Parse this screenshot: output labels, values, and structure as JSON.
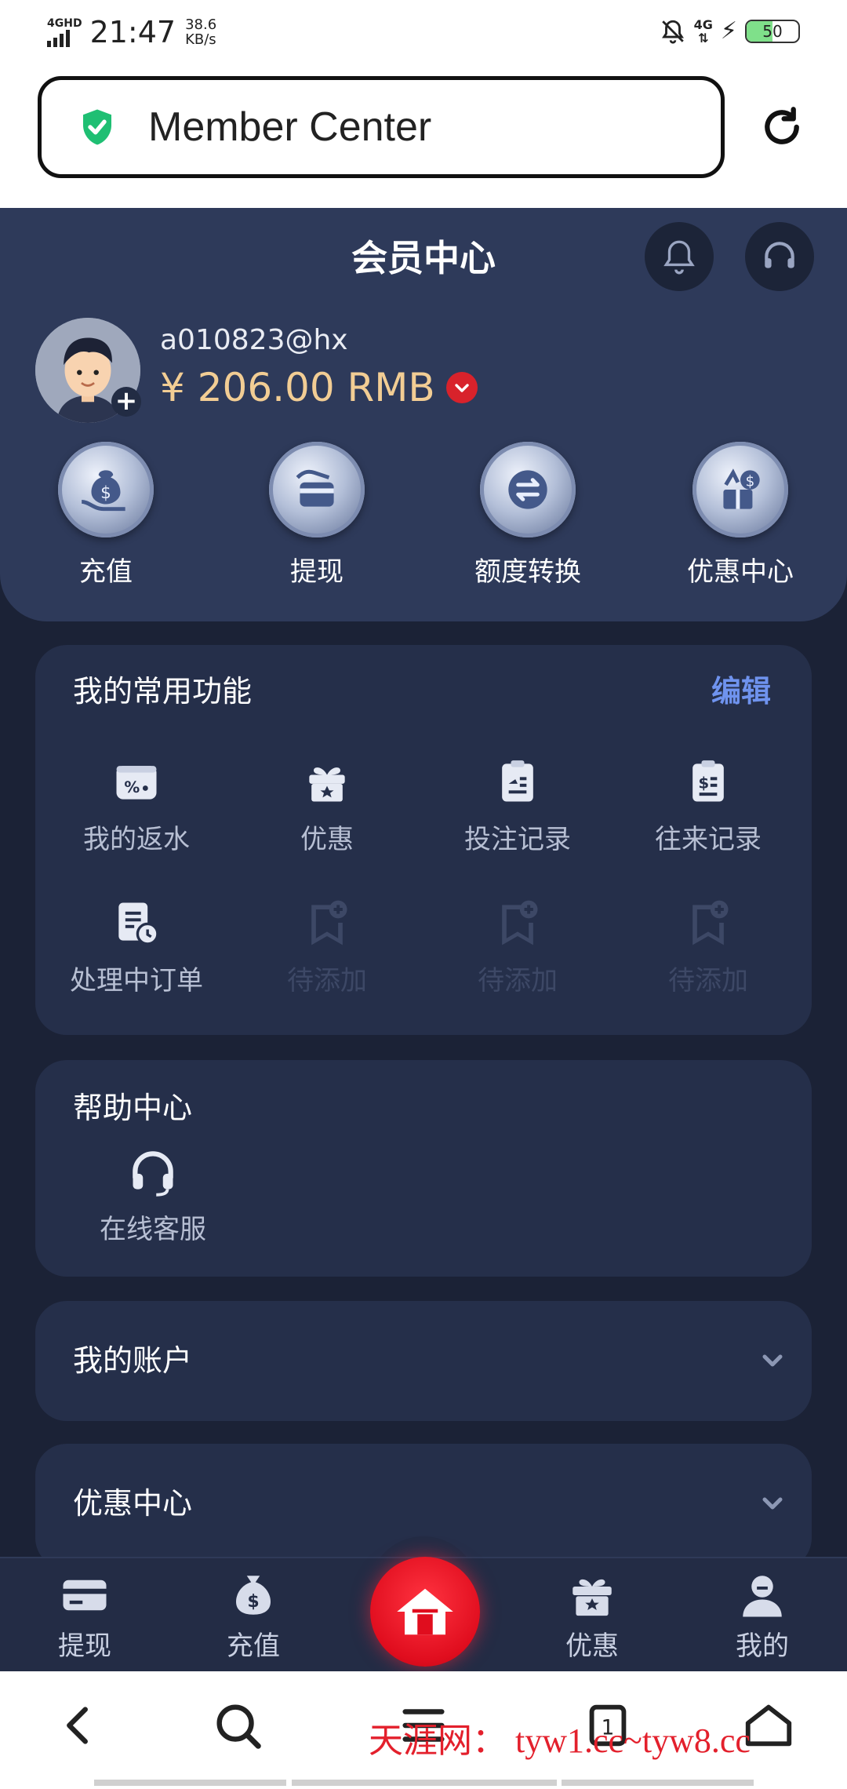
{
  "status_bar": {
    "network": "4GHD",
    "time": "21:47",
    "speed_value": "38.6",
    "speed_unit": "KB/s",
    "cell_label": "4G",
    "battery_level": "50",
    "battery_fraction": 0.5,
    "battery_color": "#7fe08a"
  },
  "browser": {
    "url_text": "Member Center",
    "shield_color": "#1fbf73"
  },
  "header": {
    "title": "会员中心",
    "username": "a010823@hx",
    "balance": "¥ 206.00 RMB",
    "balance_color": "#f2cd94",
    "quick_actions": [
      {
        "label": "充值",
        "icon": "money-bag-hand-icon"
      },
      {
        "label": "提现",
        "icon": "card-withdraw-icon"
      },
      {
        "label": "额度转换",
        "icon": "transfer-icon"
      },
      {
        "label": "优惠中心",
        "icon": "promo-gift-icon"
      }
    ]
  },
  "favorites": {
    "title": "我的常用功能",
    "edit_label": "编辑",
    "edit_color": "#6f93ee",
    "items": [
      {
        "label": "我的返水",
        "icon": "rebate-icon"
      },
      {
        "label": "优惠",
        "icon": "gift-icon"
      },
      {
        "label": "投注记录",
        "icon": "bet-record-icon"
      },
      {
        "label": "往来记录",
        "icon": "transaction-record-icon"
      },
      {
        "label": "处理中订单",
        "icon": "pending-order-icon"
      },
      {
        "label": "待添加",
        "icon": "add-bookmark-icon"
      },
      {
        "label": "待添加",
        "icon": "add-bookmark-icon"
      },
      {
        "label": "待添加",
        "icon": "add-bookmark-icon"
      }
    ]
  },
  "help": {
    "title": "帮助中心",
    "items": [
      {
        "label": "在线客服",
        "icon": "headset-icon"
      }
    ]
  },
  "sections": [
    {
      "label": "我的账户"
    },
    {
      "label": "优惠中心"
    }
  ],
  "tabbar": {
    "items": [
      {
        "label": "提现",
        "icon": "card-icon"
      },
      {
        "label": "充值",
        "icon": "money-bag-icon"
      },
      {
        "label": "",
        "icon": "home-icon"
      },
      {
        "label": "优惠",
        "icon": "gift-icon"
      },
      {
        "label": "我的",
        "icon": "user-icon"
      }
    ],
    "home_color": "#e00d1e"
  },
  "browser_nav": {
    "tab_count": "1",
    "watermark": "天涯网： tyw1.cc~tyw8.cc"
  }
}
